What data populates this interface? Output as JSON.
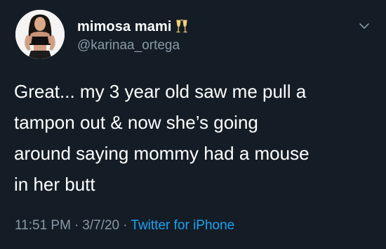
{
  "user": {
    "display_name": "mimosa mami",
    "name_emoji": "clinking-glasses",
    "handle": "@karinaa_ortega"
  },
  "tweet": {
    "text": "Great... my 3 year old saw me pull a\ntampon out & now she’s going\naround saying mommy had a mouse\nin her butt"
  },
  "meta": {
    "time": "11:51 PM",
    "separator": "·",
    "date": "3/7/20",
    "source": "Twitter for iPhone"
  },
  "colors": {
    "background": "#141d26",
    "text_primary": "#ffffff",
    "text_secondary": "#8899a6",
    "link": "#1da1f2"
  },
  "icons": {
    "menu": "chevron-down-icon"
  }
}
